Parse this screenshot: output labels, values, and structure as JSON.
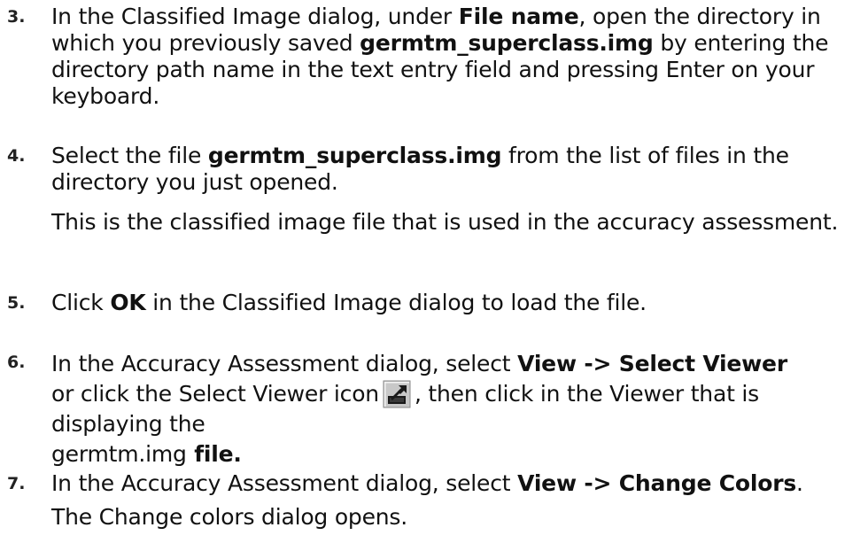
{
  "steps": [
    {
      "number": "3.",
      "parts": [
        "In the Classified Image dialog, under ",
        "File name",
        ", open the directory in which you previously saved ",
        "germtm_superclass.img",
        " by entering the directory path name in the text entry field and pressing Enter on your keyboard."
      ]
    },
    {
      "number": "4.",
      "parts": [
        "Select the file ",
        "germtm_superclass.img",
        " from the list of files in the directory you just opened."
      ],
      "note": "This is the classified image file that is used in the accuracy assessment."
    },
    {
      "number": "5.",
      "parts": [
        "Click ",
        "OK",
        " in the Classified Image dialog to load the file."
      ]
    },
    {
      "number": "6.",
      "parts": [
        "In the Accuracy Assessment dialog, select ",
        "View -> Select Viewer",
        "or click the Select Viewer icon",
        ", then click in the Viewer that is displaying the ",
        "germtm.img",
        " file."
      ],
      "icon": "select-viewer-icon"
    },
    {
      "number": "7.",
      "parts": [
        "In the Accuracy Assessment dialog, select ",
        "View -> Change Colors",
        "."
      ],
      "note": "The Change colors dialog opens."
    }
  ]
}
